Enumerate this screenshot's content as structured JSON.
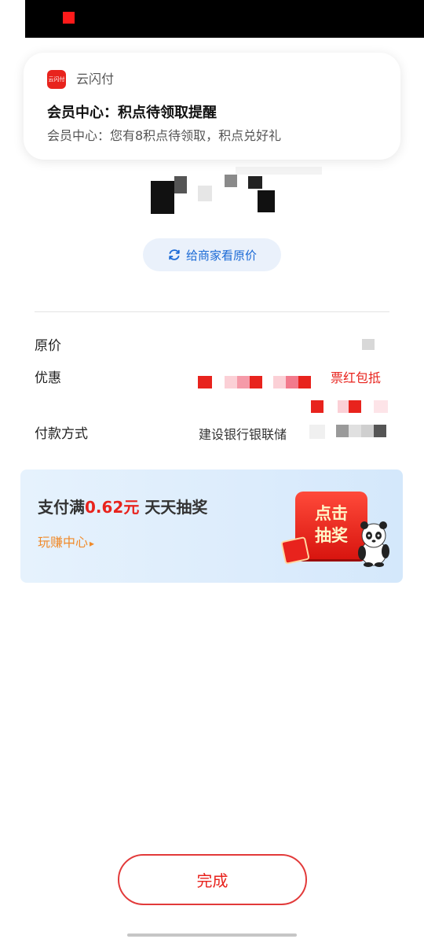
{
  "notification": {
    "app_icon_text": "云闪付",
    "app_name": "云闪付",
    "title": "会员中心：积点待领取提醒",
    "body": "会员中心：您有8积点待领取，积点兑好礼"
  },
  "payment": {
    "amount_text": "¥",
    "show_original_button": "给商家看原价",
    "rows": {
      "original_price_label": "原价",
      "discount_label": "优惠",
      "discount_value_partial": "票红包抵",
      "payment_method_label": "付款方式",
      "payment_method_value": "建设银行银联储"
    }
  },
  "promo": {
    "title_prefix": "支付满",
    "title_amount": "0.62元",
    "title_suffix": "天天抽奖",
    "link": "玩赚中心",
    "link_arrow": "▸",
    "art_text_line1": "点击",
    "art_text_line2": "抽奖"
  },
  "done_button": "完成",
  "colors": {
    "accent_red": "#e8231d",
    "link_blue": "#1b6ad6",
    "promo_orange": "#f08a2a",
    "promo_bg": "#dcecfc"
  }
}
